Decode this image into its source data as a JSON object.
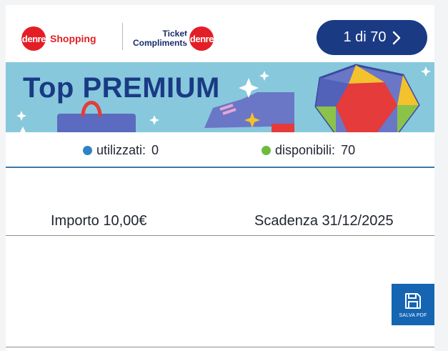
{
  "header": {
    "brand_left_badge": "Edenred",
    "brand_left_text": "Shopping",
    "brand_right_line1": "Ticket",
    "brand_right_line2": "Compliments",
    "brand_right_badge": "Edenred",
    "counter": "1 di 70",
    "counter_icon": "chevron-right-icon"
  },
  "banner": {
    "title": "Top PREMIUM"
  },
  "stats": {
    "used_label": "utilizzati:",
    "used_value": "0",
    "used_color": "#2f83c4",
    "available_label": "disponibili:",
    "available_value": "70",
    "available_color": "#6dbb3c"
  },
  "voucher": {
    "amount": "Importo 10,00€",
    "expiry": "Scadenza 31/12/2025"
  },
  "pdf": {
    "label": "SALVA PDF",
    "icon": "floppy-disk-icon"
  }
}
